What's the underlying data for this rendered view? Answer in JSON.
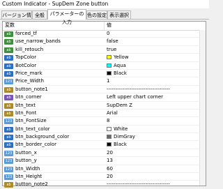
{
  "window": {
    "title": "Custom Indicator - SupDem Zone button"
  },
  "tabs": [
    {
      "label": "バージョン情報"
    },
    {
      "label": "全般"
    },
    {
      "label": "パラメーターの入力"
    },
    {
      "label": "色の設定"
    },
    {
      "label": "表示選択"
    }
  ],
  "table": {
    "headers": {
      "variable": "変数",
      "value": "値"
    },
    "rows": [
      {
        "type": "bool",
        "icon": "ab",
        "name": "forced_tf",
        "value": "0"
      },
      {
        "type": "bool",
        "icon": "ab",
        "name": "use_narrow_bands",
        "value": "false"
      },
      {
        "type": "bool",
        "icon": "ab",
        "name": "kill_retouch",
        "value": "true"
      },
      {
        "type": "color",
        "icon": "ab",
        "name": "TopColor",
        "value": "Yellow",
        "swatch": "#ffff00"
      },
      {
        "type": "color",
        "icon": "ab",
        "name": "BotColor",
        "value": "Aqua",
        "swatch": "#00ffff"
      },
      {
        "type": "color",
        "icon": "ab",
        "name": "Price_mark",
        "value": "Black",
        "swatch": "#000000"
      },
      {
        "type": "int",
        "icon": "123",
        "name": "Price_Width",
        "value": "1"
      },
      {
        "type": "str",
        "icon": "ab",
        "name": "button_note1",
        "value": "------------------------------------"
      },
      {
        "type": "enum",
        "icon": "ab",
        "name": "btn_corner",
        "value": "Left upper chart corner"
      },
      {
        "type": "str",
        "icon": "ab",
        "name": "btn_text",
        "value": "SupDem Z"
      },
      {
        "type": "str",
        "icon": "ab",
        "name": "btn_Font",
        "value": "Arial"
      },
      {
        "type": "int",
        "icon": "123",
        "name": "btn_FontSize",
        "value": "8"
      },
      {
        "type": "color",
        "icon": "ab",
        "name": "btn_text_color",
        "value": "White",
        "swatch": "#ffffff"
      },
      {
        "type": "color",
        "icon": "ab",
        "name": "btn_background_color",
        "value": "DimGray",
        "swatch": "#696969"
      },
      {
        "type": "color",
        "icon": "ab",
        "name": "btn_border_color",
        "value": "Black",
        "swatch": "#000000"
      },
      {
        "type": "int",
        "icon": "123",
        "name": "button_x",
        "value": "20"
      },
      {
        "type": "int",
        "icon": "123",
        "name": "button_y",
        "value": "13"
      },
      {
        "type": "int",
        "icon": "123",
        "name": "btn_Width",
        "value": "60"
      },
      {
        "type": "int",
        "icon": "123",
        "name": "btn_Height",
        "value": "20"
      },
      {
        "type": "str",
        "icon": "ab",
        "name": "button_note2",
        "value": "------------------------------------"
      }
    ]
  }
}
